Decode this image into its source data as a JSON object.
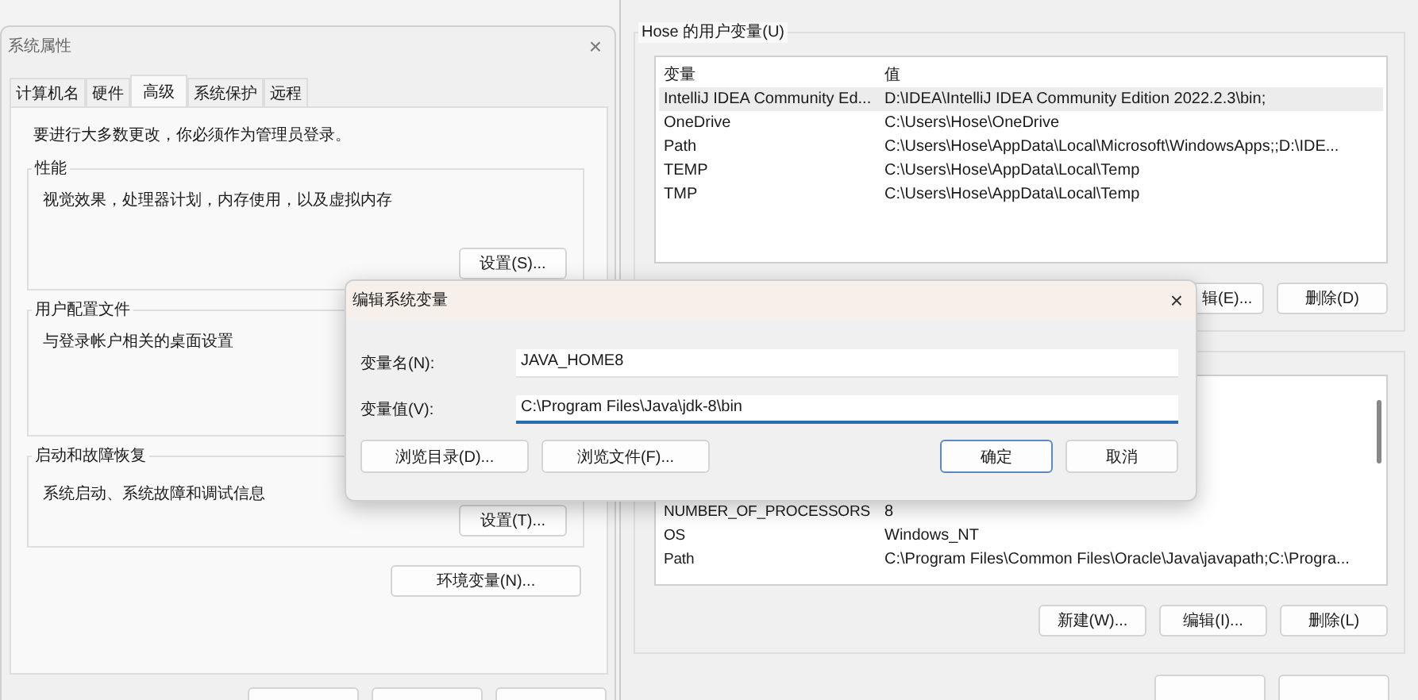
{
  "system_properties": {
    "title": "系统属性",
    "close": "×",
    "tabs": [
      {
        "label": "计算机名",
        "selected": false
      },
      {
        "label": "硬件",
        "selected": false
      },
      {
        "label": "高级",
        "selected": true
      },
      {
        "label": "系统保护",
        "selected": false
      },
      {
        "label": "远程",
        "selected": false
      }
    ],
    "notice": "要进行大多数更改，你必须作为管理员登录。",
    "groups": [
      {
        "title": "性能",
        "description": "视觉效果，处理器计划，内存使用，以及虚拟内存",
        "button": "设置(S)..."
      },
      {
        "title": "用户配置文件",
        "description": "与登录帐户相关的桌面设置"
      },
      {
        "title": "启动和故障恢复",
        "description": "系统启动、系统故障和调试信息",
        "button": "设置(T)..."
      }
    ],
    "env_button": "环境变量(N)..."
  },
  "environment_variables": {
    "user_group_title": "Hose 的用户变量(U)",
    "columns": [
      "变量",
      "值"
    ],
    "user_rows": [
      {
        "name": "IntelliJ IDEA Community Ed...",
        "value": "D:\\IDEA\\IntelliJ IDEA Community Edition 2022.2.3\\bin;",
        "selected": true
      },
      {
        "name": "OneDrive",
        "value": "C:\\Users\\Hose\\OneDrive",
        "selected": false
      },
      {
        "name": "Path",
        "value": "C:\\Users\\Hose\\AppData\\Local\\Microsoft\\WindowsApps;;D:\\IDE...",
        "selected": false
      },
      {
        "name": "TEMP",
        "value": "C:\\Users\\Hose\\AppData\\Local\\Temp",
        "selected": false
      },
      {
        "name": "TMP",
        "value": "C:\\Users\\Hose\\AppData\\Local\\Temp",
        "selected": false
      }
    ],
    "user_buttons": [
      "辑(E)...",
      "删除(D)"
    ],
    "system_rows": [
      {
        "name": "NUMBER_OF_PROCESSORS",
        "value": "8"
      },
      {
        "name": "OS",
        "value": "Windows_NT"
      },
      {
        "name": "Path",
        "value": "C:\\Program Files\\Common Files\\Oracle\\Java\\javapath;C:\\Progra..."
      }
    ],
    "system_buttons": [
      "新建(W)...",
      "编辑(I)...",
      "删除(L)"
    ]
  },
  "dialog": {
    "title": "编辑系统变量",
    "close": "×",
    "fields": [
      {
        "label": "变量名(N):",
        "value": "JAVA_HOME8",
        "focused": false
      },
      {
        "label": "变量值(V):",
        "value": "C:\\Program Files\\Java\\jdk-8\\bin",
        "focused": true
      }
    ],
    "browse_buttons": [
      "浏览目录(D)...",
      "浏览文件(F)..."
    ],
    "buttons": [
      {
        "label": "确定",
        "default": true
      },
      {
        "label": "取消",
        "default": false
      }
    ]
  }
}
